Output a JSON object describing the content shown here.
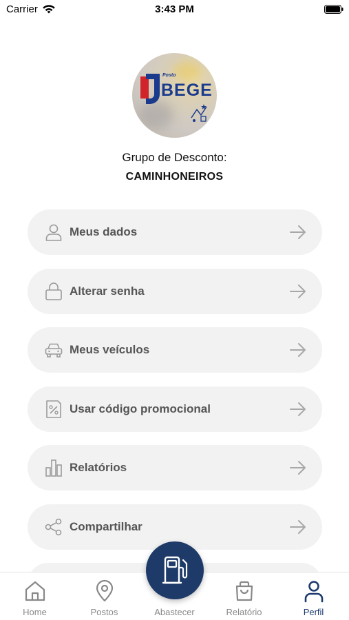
{
  "status_bar": {
    "carrier": "Carrier",
    "time": "3:43 PM"
  },
  "profile": {
    "logo_small_text": "Posto",
    "logo_text": "BEGE",
    "group_label": "Grupo de Desconto:",
    "group_name": "CAMINHONEIROS"
  },
  "menu": {
    "items": [
      {
        "label": "Meus dados",
        "icon": "user-icon"
      },
      {
        "label": "Alterar senha",
        "icon": "lock-icon"
      },
      {
        "label": "Meus veículos",
        "icon": "car-icon"
      },
      {
        "label": "Usar código promocional",
        "icon": "discount-icon"
      },
      {
        "label": "Relatórios",
        "icon": "bar-chart-icon"
      },
      {
        "label": "Compartilhar",
        "icon": "share-icon"
      }
    ]
  },
  "tab_bar": {
    "tabs": [
      {
        "label": "Home",
        "icon": "home-icon"
      },
      {
        "label": "Postos",
        "icon": "map-pin-icon"
      },
      {
        "label": "Abastecer",
        "icon": "fuel-pump-icon"
      },
      {
        "label": "Relatório",
        "icon": "shopping-bag-icon"
      },
      {
        "label": "Perfil",
        "icon": "person-icon"
      }
    ],
    "active": "Perfil"
  },
  "colors": {
    "accent": "#1e3a68",
    "menu_bg": "#f2f2f2",
    "menu_text": "#555555",
    "tab_inactive": "#888888"
  }
}
